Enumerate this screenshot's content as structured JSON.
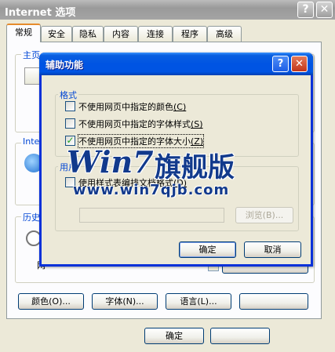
{
  "main_window": {
    "title": "Internet 选项",
    "title_help": "?",
    "title_close": "✕",
    "tabs": [
      "常规",
      "安全",
      "隐私",
      "内容",
      "连接",
      "程序",
      "高级"
    ],
    "groups": {
      "homepage_label": "主页",
      "temp_files_label": "Inte",
      "history_label": "历史",
      "history_days_partial": "网"
    },
    "bottom_buttons": [
      "颜色(O)...",
      "字体(N)...",
      "语言(L)..."
    ],
    "ok_label": "确定"
  },
  "dialog": {
    "title": "辅助功能",
    "help": "?",
    "close": "✕",
    "format_group": {
      "label": "格式",
      "items": [
        {
          "text": "不使用网页中指定的颜色",
          "key": "(C)",
          "checked": false
        },
        {
          "text": "不使用网页中指定的字体样式",
          "key": "(S)",
          "checked": false
        },
        {
          "text": "不使用网页中指定的字体大小",
          "key": "(Z)",
          "checked": true
        }
      ]
    },
    "user_style_group": {
      "label": "用户",
      "checkbox_text": "使用样式表编排文档格式",
      "checkbox_key": "(D)",
      "checked": false,
      "browse_label": "浏览(B)..."
    },
    "ok_label": "确定",
    "cancel_label": "取消"
  },
  "watermark": {
    "logo_text": "Win7",
    "logo_cn": "旗舰版",
    "url": "www.win7qjb.com"
  }
}
